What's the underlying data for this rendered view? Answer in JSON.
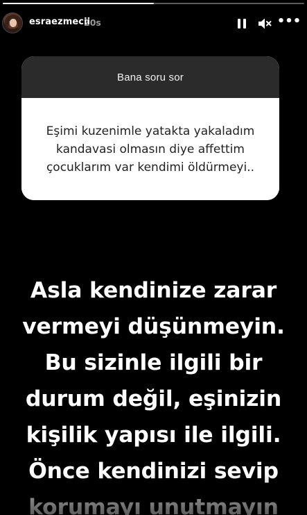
{
  "story": {
    "progress": 0.5,
    "username": "esraezmecii",
    "time_ago": "20s"
  },
  "controls": {
    "pause_icon": "pause-icon",
    "mute_icon": "volume-muted-icon",
    "more_icon": "more-options-icon",
    "more_glyph": "•••",
    "mute_glyph": "🔇"
  },
  "question_box": {
    "title": "Bana soru sor",
    "question": "Eşimi kuzenimle yatakta yakaladım kandavasi olmasın diye affettim çocuklarım var kendimi öldürmeyi.."
  },
  "answer": {
    "lines": [
      "Asla kendinize zarar",
      "vermeyi düşünmeyin.",
      "Bu sizinle ilgili bir",
      "durum değil, eşinizin",
      "kişilik yapısı ile ilgili.",
      "Önce kendinizi sevip",
      "korumayı unutmayın"
    ]
  },
  "colors": {
    "background": "#000000",
    "question_header": "#2b2b2b",
    "question_body": "#ffffff",
    "text": "#ffffff"
  }
}
